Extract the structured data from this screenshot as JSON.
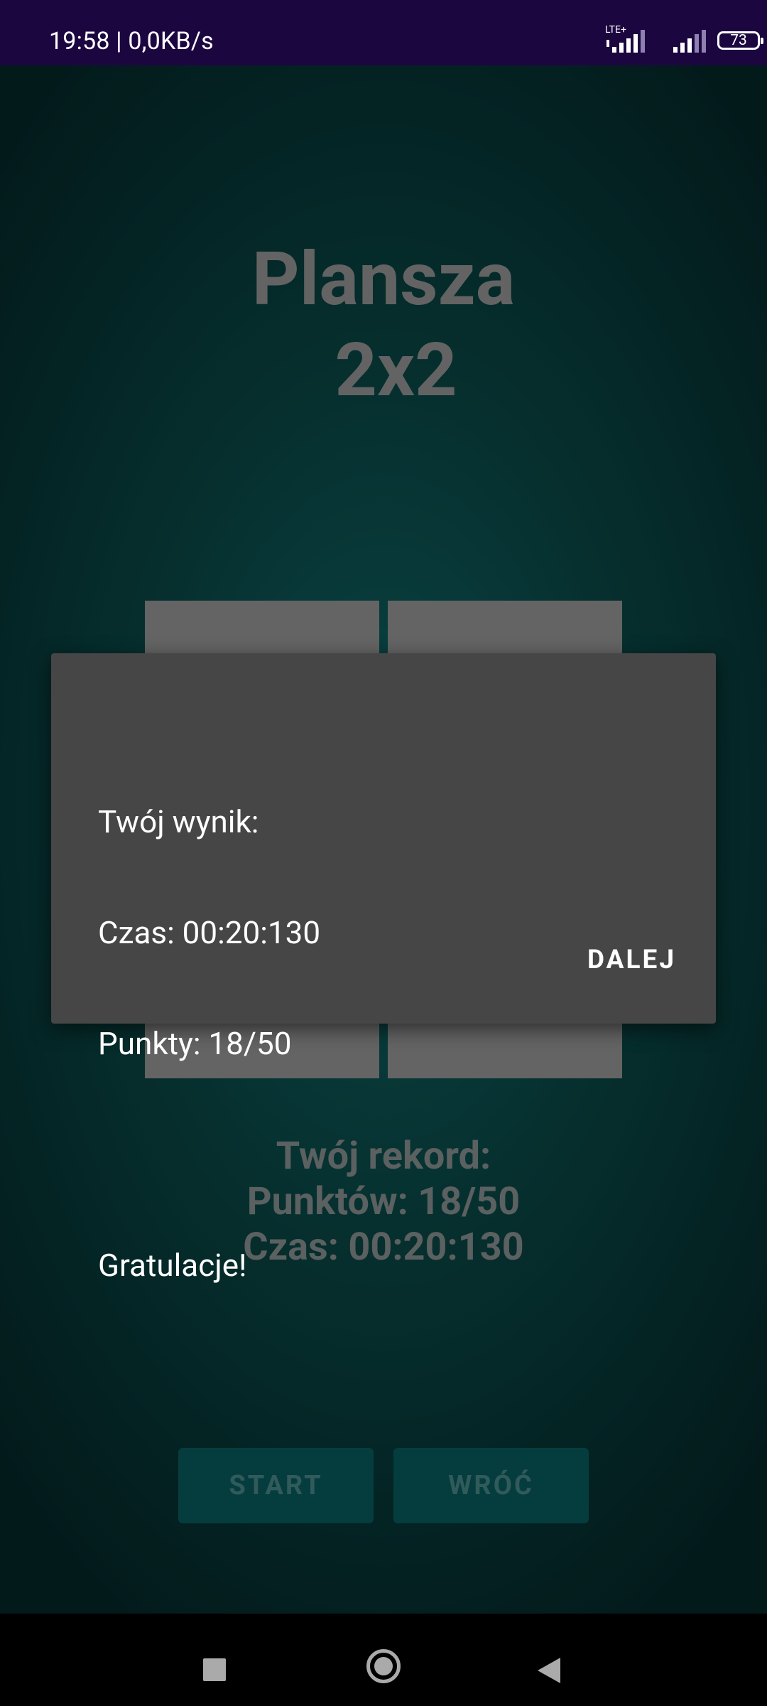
{
  "status_bar": {
    "time_speed": "19:58 | 0,0KB/s",
    "network_label": "LTE+",
    "battery_level": "73",
    "icons": [
      "signal-strength-icon",
      "signal-strength-icon",
      "battery-icon"
    ]
  },
  "screen": {
    "title_line1": "Plansza",
    "title_line2": "2x2"
  },
  "record": {
    "heading": "Twój rekord:",
    "points": "Punktów: 18/50",
    "time": "Czas: 00:20:130"
  },
  "buttons": {
    "start": "START",
    "back": "WRÓĆ"
  },
  "dialog": {
    "line1": "Twój wynik:",
    "line2": "Czas: 00:20:130",
    "line3": "Punkty: 18/50",
    "line4": "",
    "line5": "Gratulacje!",
    "confirm": "DALEJ"
  },
  "nav_bar": {
    "icons": [
      "recents-square-icon",
      "home-circle-icon",
      "back-triangle-icon"
    ]
  }
}
